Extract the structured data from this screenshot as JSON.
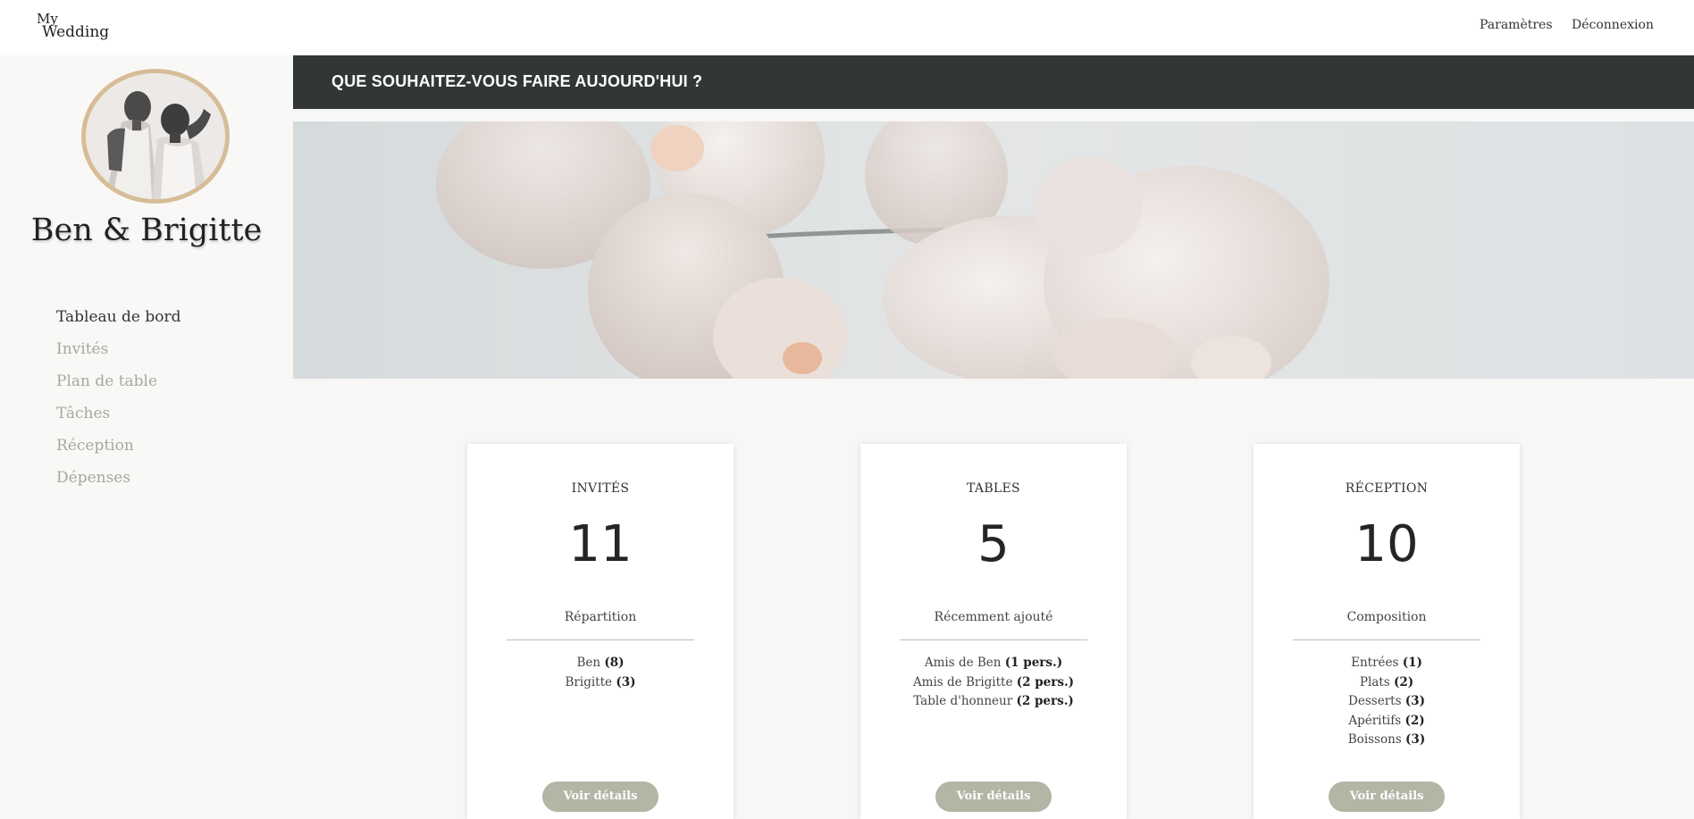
{
  "app": {
    "logo_line1": "My",
    "logo_line2": "Wedding",
    "links": {
      "settings": "Paramètres",
      "logout": "Déconnexion"
    }
  },
  "sidebar": {
    "couple_name": "Ben & Brigitte",
    "items": [
      {
        "label": "Tableau de bord",
        "active": true
      },
      {
        "label": "Invités"
      },
      {
        "label": "Plan de table"
      },
      {
        "label": "Tâches"
      },
      {
        "label": "Réception"
      },
      {
        "label": "Dépenses"
      }
    ]
  },
  "header": {
    "title": "QUE SOUHAITEZ-VOUS FAIRE AUJOURD'HUI ?"
  },
  "cards": [
    {
      "title": "INVITÉS",
      "number": "11",
      "subtitle": "Répartition",
      "items": [
        {
          "name": "Ben",
          "value": "(8)"
        },
        {
          "name": "Brigitte",
          "value": "(3)"
        }
      ],
      "button": "Voir détails"
    },
    {
      "title": "TABLES",
      "number": "5",
      "subtitle": "Récemment ajouté",
      "items": [
        {
          "name": "Amis de Ben",
          "value": "(1 pers.)"
        },
        {
          "name": "Amis de Brigitte",
          "value": "(2 pers.)"
        },
        {
          "name": "Table d'honneur",
          "value": "(2 pers.)"
        }
      ],
      "button": "Voir détails"
    },
    {
      "title": "RÉCEPTION",
      "number": "10",
      "subtitle": "Composition",
      "items": [
        {
          "name": "Entrées",
          "value": "(1)"
        },
        {
          "name": "Plats",
          "value": "(2)"
        },
        {
          "name": "Desserts",
          "value": "(3)"
        },
        {
          "name": "Apéritifs",
          "value": "(2)"
        },
        {
          "name": "Boissons",
          "value": "(3)"
        }
      ],
      "button": "Voir détails"
    }
  ],
  "colors": {
    "header_band": "#333637",
    "avatar_ring": "#d6bd96",
    "button": "#b4b5a5",
    "sidebar_bg": "#f9f8f6"
  }
}
